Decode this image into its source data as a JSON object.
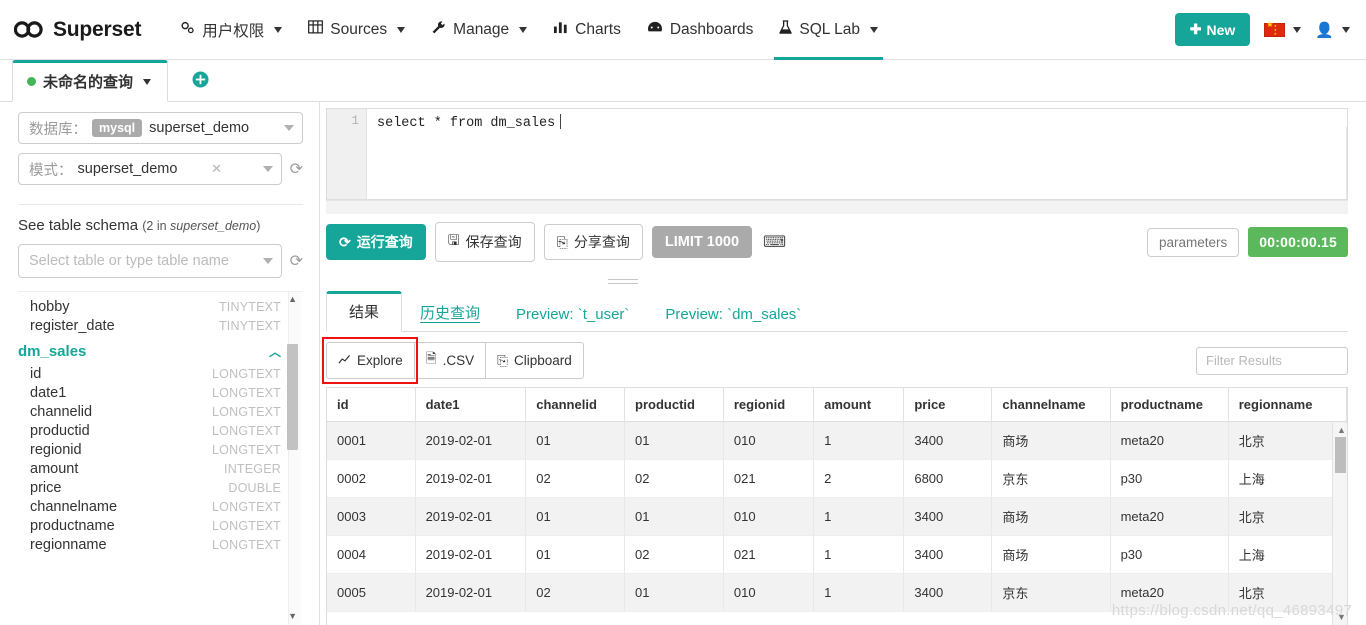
{
  "navbar": {
    "brand": "Superset",
    "items": [
      {
        "label": "用户权限",
        "icon": "gears-icon",
        "caret": true
      },
      {
        "label": "Sources",
        "icon": "table-icon",
        "caret": true
      },
      {
        "label": "Manage",
        "icon": "wrench-icon",
        "caret": true
      },
      {
        "label": "Charts",
        "icon": "bar-chart-icon",
        "caret": false
      },
      {
        "label": "Dashboards",
        "icon": "dashboard-icon",
        "caret": false
      },
      {
        "label": "SQL Lab",
        "icon": "flask-icon",
        "caret": true,
        "active": true
      }
    ],
    "new_button": "New",
    "new_button_icon": "plus-icon",
    "language_icon": "china-flag-icon",
    "user_icon": "user-icon",
    "accent_color": "#15a699"
  },
  "query_tabs": {
    "active_tab": "未命名的查询",
    "status_dot_color": "#44b556",
    "add_tab_icon": "plus-circle-icon"
  },
  "left_panel": {
    "database": {
      "label": "数据库：",
      "engine_badge": "mysql",
      "value": "superset_demo"
    },
    "schema": {
      "label": "模式：",
      "value": "superset_demo",
      "clear_icon": "close-icon",
      "refresh_icon": "refresh-icon"
    },
    "schema_header": "See table schema",
    "schema_header_count": "(2 in ",
    "schema_header_db": "superset_demo",
    "schema_header_close": ")",
    "table_select_placeholder": "Select table or type table name",
    "orphan_columns": [
      {
        "name": "hobby",
        "type": "TINYTEXT"
      },
      {
        "name": "register_date",
        "type": "TINYTEXT"
      }
    ],
    "table_name": "dm_sales",
    "table_collapse_icon": "chevron-up-icon",
    "columns": [
      {
        "name": "id",
        "type": "LONGTEXT"
      },
      {
        "name": "date1",
        "type": "LONGTEXT"
      },
      {
        "name": "channelid",
        "type": "LONGTEXT"
      },
      {
        "name": "productid",
        "type": "LONGTEXT"
      },
      {
        "name": "regionid",
        "type": "LONGTEXT"
      },
      {
        "name": "amount",
        "type": "INTEGER"
      },
      {
        "name": "price",
        "type": "DOUBLE"
      },
      {
        "name": "channelname",
        "type": "LONGTEXT"
      },
      {
        "name": "productname",
        "type": "LONGTEXT"
      },
      {
        "name": "regionname",
        "type": "LONGTEXT"
      }
    ]
  },
  "editor": {
    "line_number": "1",
    "sql": "select * from dm_sales"
  },
  "run_bar": {
    "run_label": "运行查询",
    "run_icon": "refresh-icon",
    "save_label": "保存查询",
    "save_icon": "save-icon",
    "share_label": "分享查询",
    "share_icon": "copy-icon",
    "limit_label": "LIMIT 1000",
    "keyboard_icon": "keyboard-icon",
    "parameters_label": "parameters",
    "timer": "00:00:00.15",
    "timer_color": "#5cb85c"
  },
  "result_tabs": [
    {
      "label": "结果",
      "active": true
    },
    {
      "label": "历史查询",
      "active": false,
      "underline": true
    },
    {
      "label": "Preview: `t_user`",
      "active": false
    },
    {
      "label": "Preview: `dm_sales`",
      "active": false
    }
  ],
  "result_toolbar": {
    "explore_label": "Explore",
    "explore_icon": "chart-line-icon",
    "explore_highlight_color": "#ee1111",
    "csv_label": ".CSV",
    "csv_icon": "file-icon",
    "clipboard_label": "Clipboard",
    "clipboard_icon": "clipboard-icon",
    "filter_placeholder": "Filter Results"
  },
  "results_table": {
    "columns": [
      "id",
      "date1",
      "channelid",
      "productid",
      "regionid",
      "amount",
      "price",
      "channelname",
      "productname",
      "regionname"
    ],
    "rows": [
      [
        "0001",
        "2019-02-01",
        "01",
        "01",
        "010",
        "1",
        "3400",
        "商场",
        "meta20",
        "北京"
      ],
      [
        "0002",
        "2019-02-01",
        "02",
        "02",
        "021",
        "2",
        "6800",
        "京东",
        "p30",
        "上海"
      ],
      [
        "0003",
        "2019-02-01",
        "01",
        "01",
        "010",
        "1",
        "3400",
        "商场",
        "meta20",
        "北京"
      ],
      [
        "0004",
        "2019-02-01",
        "01",
        "02",
        "021",
        "1",
        "3400",
        "商场",
        "p30",
        "上海"
      ],
      [
        "0005",
        "2019-02-01",
        "02",
        "01",
        "010",
        "1",
        "3400",
        "京东",
        "meta20",
        "北京"
      ]
    ]
  },
  "watermark": "https://blog.csdn.net/qq_46893497"
}
